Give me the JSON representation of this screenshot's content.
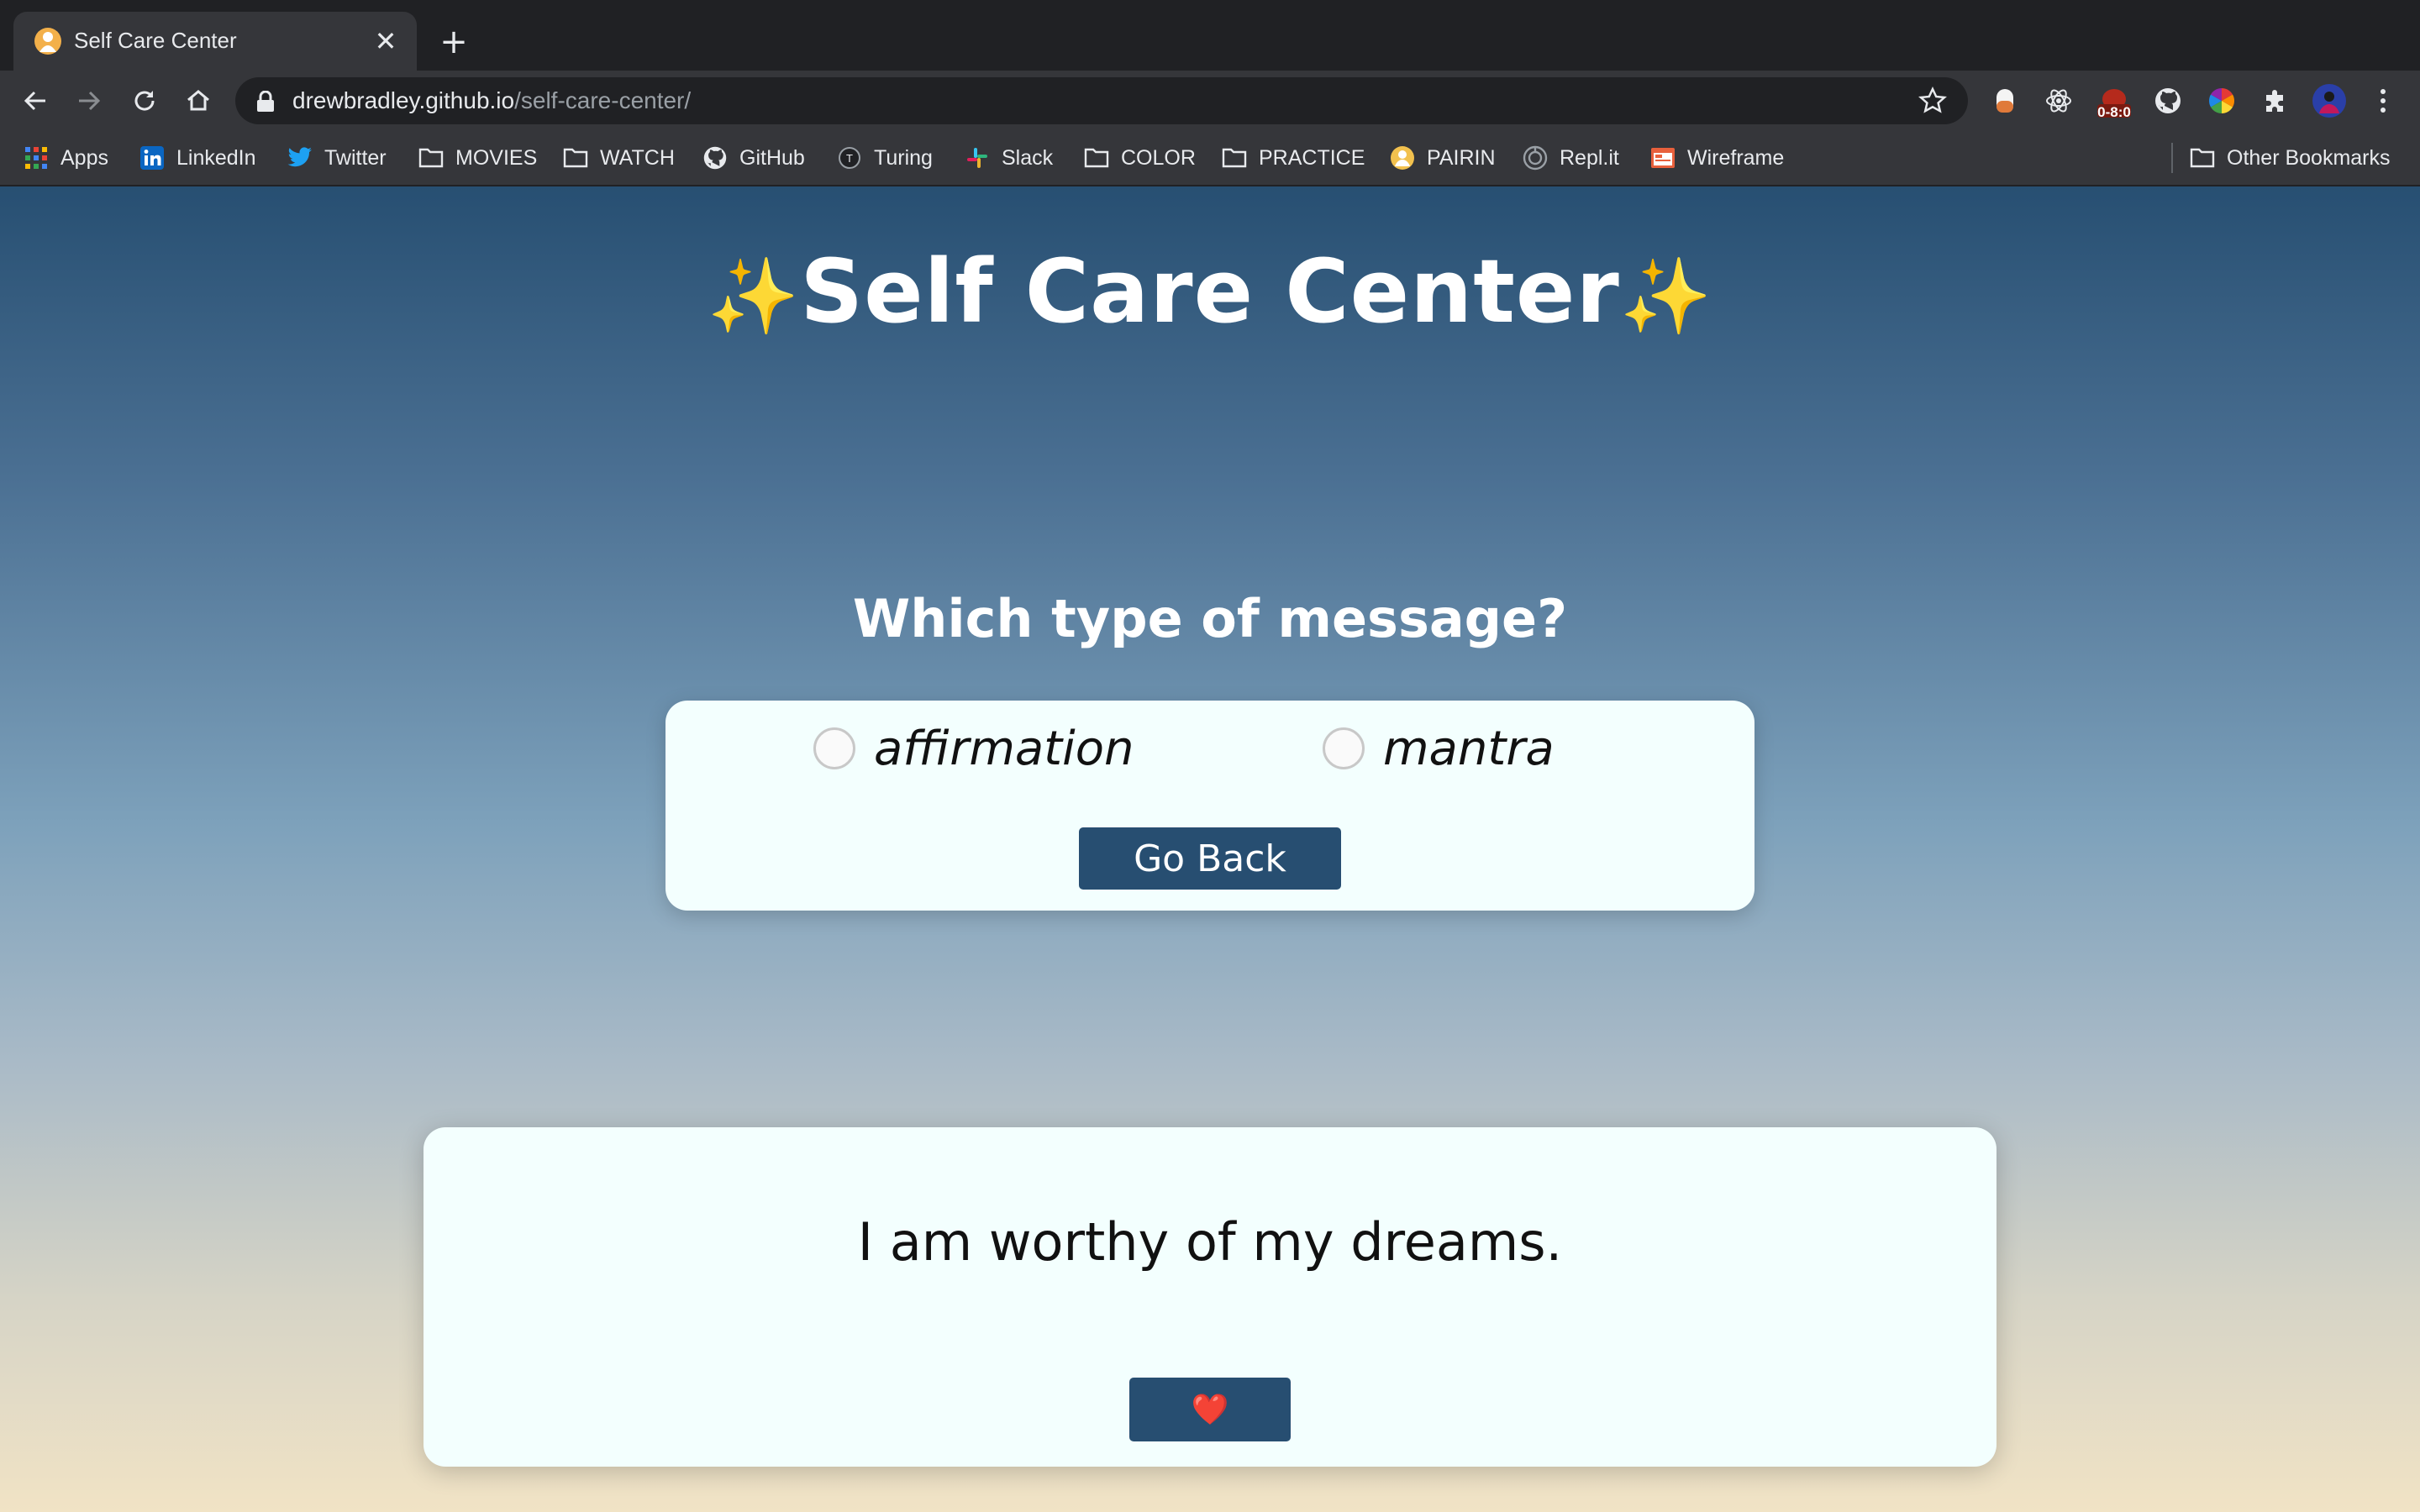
{
  "browser": {
    "tab": {
      "title": "Self Care Center",
      "close_glyph": "✕"
    },
    "new_tab_glyph": "+",
    "url": {
      "host": "drewbradley.github.io",
      "path": "/self-care-center/"
    },
    "extension_badge": "0-8:0",
    "bookmarks": [
      {
        "label": "Apps",
        "icon": "apps-grid-icon"
      },
      {
        "label": "LinkedIn",
        "icon": "linkedin-icon"
      },
      {
        "label": "Twitter",
        "icon": "twitter-icon"
      },
      {
        "label": "MOVIES",
        "icon": "folder-icon"
      },
      {
        "label": "WATCH",
        "icon": "folder-icon"
      },
      {
        "label": "GitHub",
        "icon": "github-icon"
      },
      {
        "label": "Turing",
        "icon": "turing-icon"
      },
      {
        "label": "Slack",
        "icon": "slack-icon"
      },
      {
        "label": "COLOR",
        "icon": "folder-icon"
      },
      {
        "label": "PRACTICE",
        "icon": "folder-icon"
      },
      {
        "label": "PAIRIN",
        "icon": "pairin-icon"
      },
      {
        "label": "Repl.it",
        "icon": "replit-icon"
      },
      {
        "label": "Wireframe",
        "icon": "wireframe-icon"
      }
    ],
    "other_bookmarks": "Other Bookmarks"
  },
  "page": {
    "title": "Self Care Center",
    "title_sparkle": "✨",
    "question": "Which type of message?",
    "options": [
      {
        "label": "affirmation",
        "checked": false
      },
      {
        "label": "mantra",
        "checked": false
      }
    ],
    "go_back_label": "Go Back",
    "message": "I am worthy of my dreams.",
    "favorite_glyph": "❤️"
  },
  "colors": {
    "button": "#274e71",
    "card": "#f3fffe",
    "title_text": "#ffffff",
    "gradient_top": "#274f72",
    "gradient_bottom": "#f1e3c5"
  }
}
